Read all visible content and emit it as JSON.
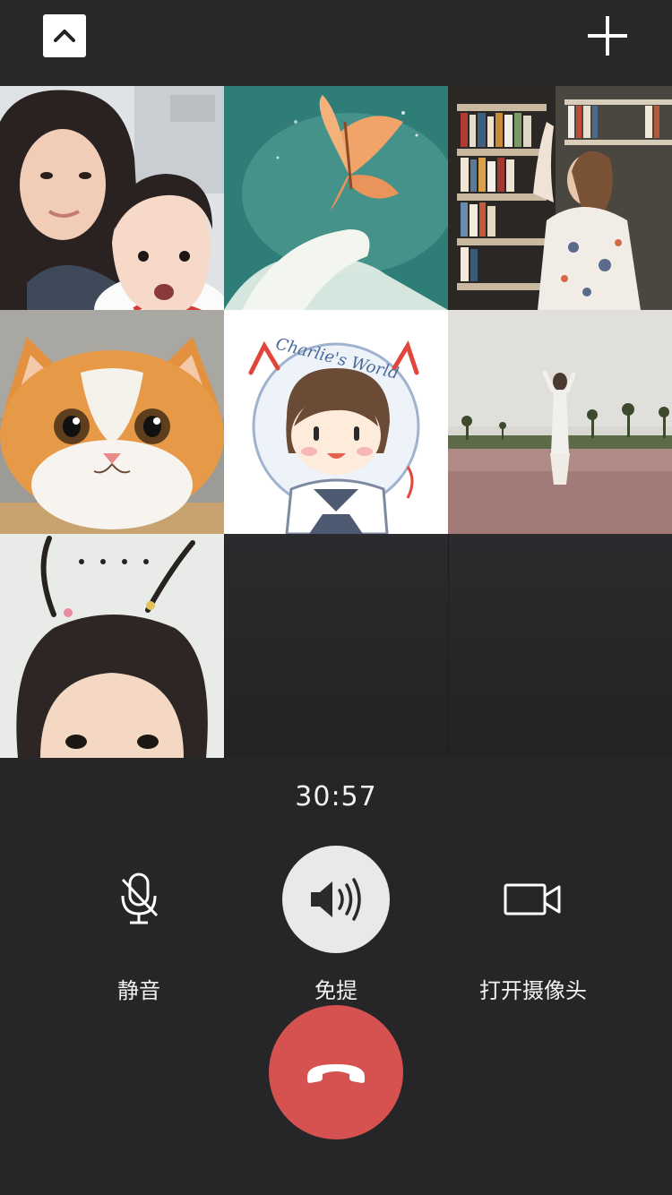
{
  "call": {
    "duration": "30:57"
  },
  "controls": {
    "mute_label": "静音",
    "speaker_label": "免提",
    "camera_label": "打开摄像头"
  },
  "participants": [
    {
      "avatar": "mother-and-child-photo-avatar"
    },
    {
      "avatar": "butterfly-hand-illustration-avatar"
    },
    {
      "avatar": "woman-in-bookstore-photo-avatar"
    },
    {
      "avatar": "orange-cat-photo-avatar"
    },
    {
      "avatar": "cartoon-boy-charlies-world-avatar",
      "text": "Charlie's World"
    },
    {
      "avatar": "woman-in-grass-field-photo-avatar"
    },
    {
      "avatar": "little-girl-pigtails-photo-avatar",
      "status": "connecting"
    }
  ],
  "icons": {
    "minimize": "chevron-up-icon",
    "add": "plus-icon",
    "mute": "microphone-muted-icon",
    "speaker": "speaker-icon",
    "camera": "video-camera-icon",
    "hangup": "phone-hangup-icon"
  },
  "colors": {
    "background": "#262628",
    "hangup": "#d65251",
    "active_control": "#e9e9ea"
  }
}
